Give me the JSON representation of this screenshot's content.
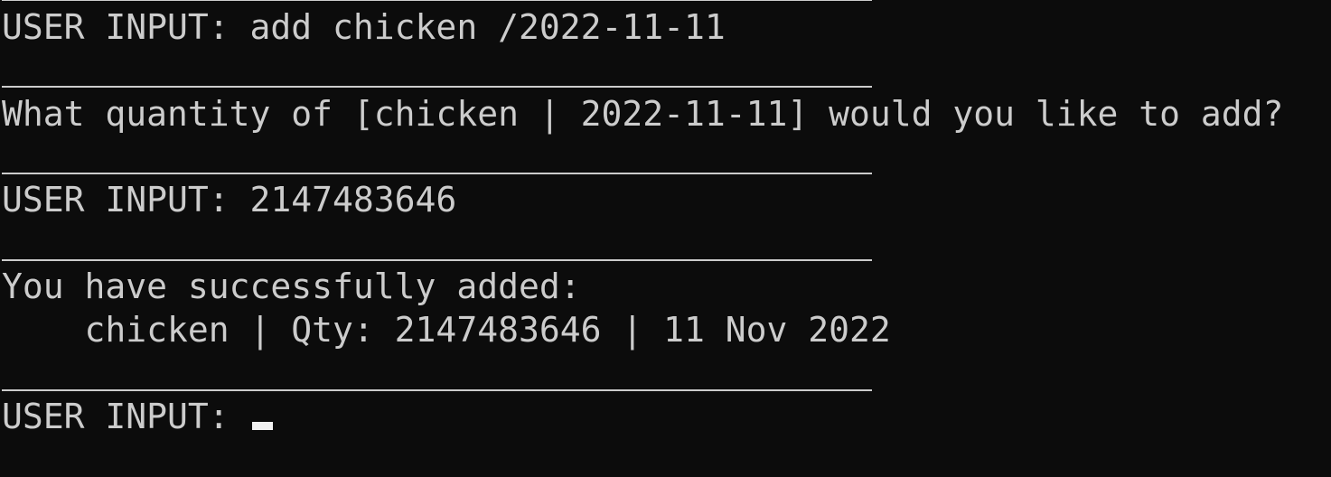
{
  "terminal": {
    "line1": "USER INPUT: add chicken /2022-11-11",
    "line2": "What quantity of [chicken | 2022-11-11] would you like to add?",
    "line3": "USER INPUT: 2147483646",
    "line4": "You have successfully added:",
    "line5": "    chicken | Qty: 2147483646 | 11 Nov 2022",
    "prompt": "USER INPUT: "
  },
  "colors": {
    "background": "#0c0c0c",
    "foreground": "#cccccc",
    "cursor": "#f2f2f2"
  }
}
